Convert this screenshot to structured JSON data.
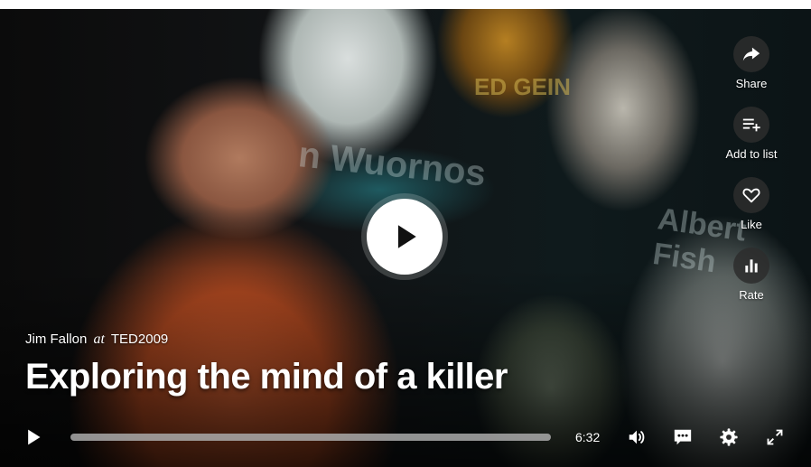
{
  "video": {
    "speaker": "Jim Fallon",
    "at_word": "at",
    "event": "TED2009",
    "title": "Exploring the mind of a killer"
  },
  "background_text": {
    "name1": "n Wuornos",
    "name2": "Albert Fish",
    "sign": "ED GEIN"
  },
  "side_actions": [
    {
      "label": "Share",
      "icon": "share-arrow-icon"
    },
    {
      "label": "Add to list",
      "icon": "playlist-add-icon"
    },
    {
      "label": "Like",
      "icon": "heart-icon"
    },
    {
      "label": "Rate",
      "icon": "bar-chart-icon"
    }
  ],
  "controls": {
    "duration": "6:32",
    "progress": 0,
    "icons": [
      "play-icon",
      "volume-icon",
      "captions-icon",
      "settings-icon",
      "fullscreen-icon"
    ]
  },
  "colors": {
    "accent": "#e62b1e",
    "control_bg": "#2d2d2d",
    "text": "#ffffff"
  }
}
